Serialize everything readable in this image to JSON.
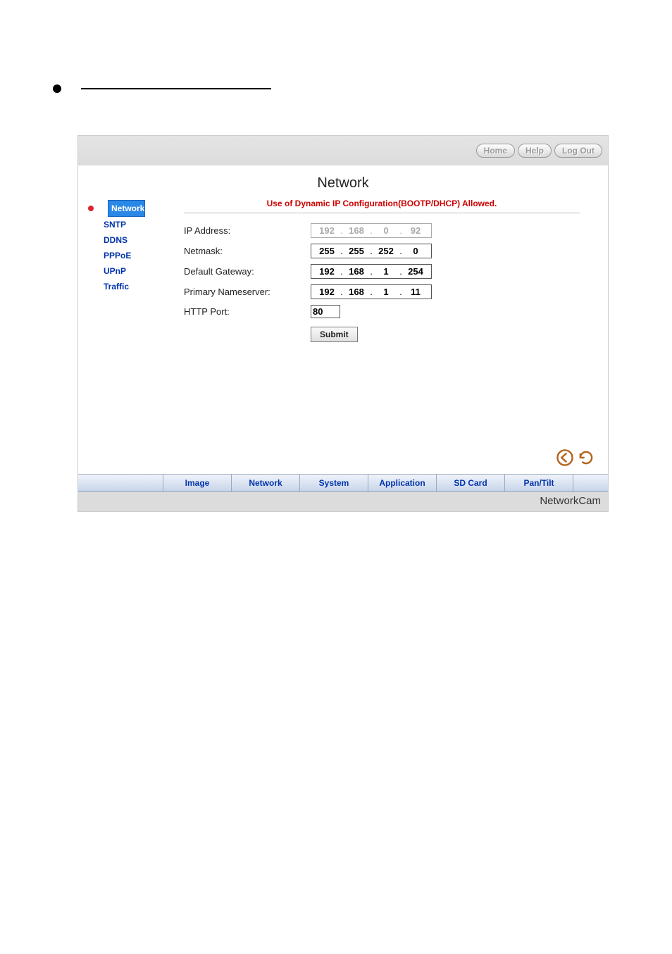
{
  "top_buttons": {
    "home": "Home",
    "help": "Help",
    "logout": "Log Out"
  },
  "page_title": "Network",
  "sidebar": {
    "items": [
      {
        "label": "Network",
        "active": true
      },
      {
        "label": "SNTP",
        "active": false
      },
      {
        "label": "DDNS",
        "active": false
      },
      {
        "label": "PPPoE",
        "active": false
      },
      {
        "label": "UPnP",
        "active": false
      },
      {
        "label": "Traffic",
        "active": false
      }
    ]
  },
  "status_message": "Use of Dynamic IP Configuration(BOOTP/DHCP) Allowed.",
  "form": {
    "ip_address": {
      "label": "IP Address:",
      "octets": [
        "192",
        "168",
        "0",
        "92"
      ],
      "disabled": true
    },
    "netmask": {
      "label": "Netmask:",
      "octets": [
        "255",
        "255",
        "252",
        "0"
      ],
      "disabled": false
    },
    "gateway": {
      "label": "Default Gateway:",
      "octets": [
        "192",
        "168",
        "1",
        "254"
      ],
      "disabled": false
    },
    "nameserver": {
      "label": "Primary Nameserver:",
      "octets": [
        "192",
        "168",
        "1",
        "11"
      ],
      "disabled": false
    },
    "http_port": {
      "label": "HTTP Port:",
      "value": "80"
    },
    "submit_label": "Submit"
  },
  "bottom_tabs": [
    "Image",
    "Network",
    "System",
    "Application",
    "SD Card",
    "Pan/Tilt"
  ],
  "brand": "NetworkCam"
}
